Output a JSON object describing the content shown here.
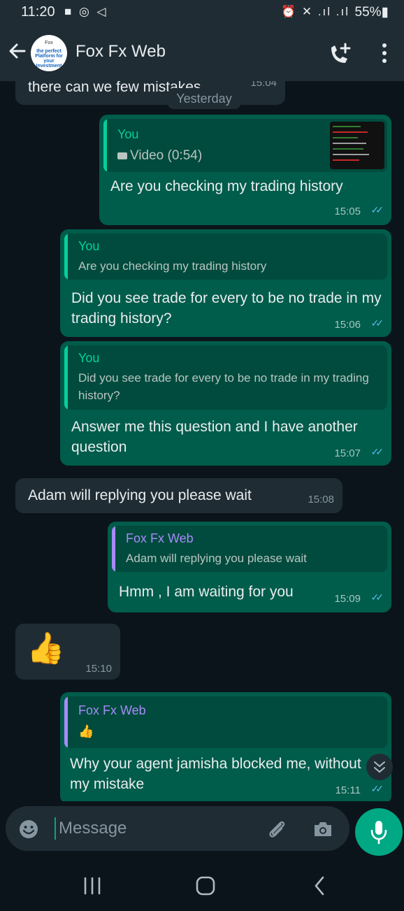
{
  "status": {
    "time": "11:20",
    "left_icons": "■ ◎ ◁",
    "right_icons": "⏰ ✕ .ıl .ıl",
    "battery": "55%▮"
  },
  "header": {
    "contact_name": "Fox Fx Web",
    "avatar_lines": [
      "Fox",
      "the perfect Platform for your Investment",
      ""
    ]
  },
  "chat": {
    "top_partial": {
      "text": "there can we few mistakes",
      "time": "15:04"
    },
    "date_chip": "Yesterday",
    "messages": [
      {
        "quote_name": "You",
        "quote_text": "Video (0:54)",
        "text": "Are you checking my trading history",
        "time": "15:05"
      },
      {
        "quote_name": "You",
        "quote_text": "Are you checking my trading history",
        "text": "Did you see trade for every to be no trade in my trading history?",
        "time": "15:06"
      },
      {
        "quote_name": "You",
        "quote_text": "Did you see trade for every to be no trade in my trading history?",
        "text": "Answer me this question and I have another question",
        "time": "15:07"
      },
      {
        "text": "Adam will replying you please wait",
        "time": "15:08"
      },
      {
        "quote_name": "Fox Fx Web",
        "quote_text": "Adam will replying you please wait",
        "text": "Hmm , I am waiting for you",
        "time": "15:09"
      },
      {
        "emoji": "👍",
        "time": "15:10"
      },
      {
        "quote_name": "Fox Fx Web",
        "quote_text": "👍",
        "text": "Why your agent jamisha blocked me, without my mistake",
        "time": "15:11"
      }
    ]
  },
  "composer": {
    "placeholder": "Message"
  },
  "colors": {
    "outgoing_bubble": "#005c4b",
    "incoming_bubble": "#1f2c34",
    "accent": "#00a884",
    "read_ticks": "#53bdeb",
    "you_name": "#06cf9c",
    "contact_name": "#a78bfa"
  },
  "icons": [
    "back-arrow-icon",
    "add-call-icon",
    "more-options-icon",
    "video-icon",
    "emoji-icon",
    "attach-icon",
    "camera-icon",
    "mic-icon",
    "scroll-down-icon",
    "recent-apps-icon",
    "home-icon",
    "back-icon"
  ]
}
